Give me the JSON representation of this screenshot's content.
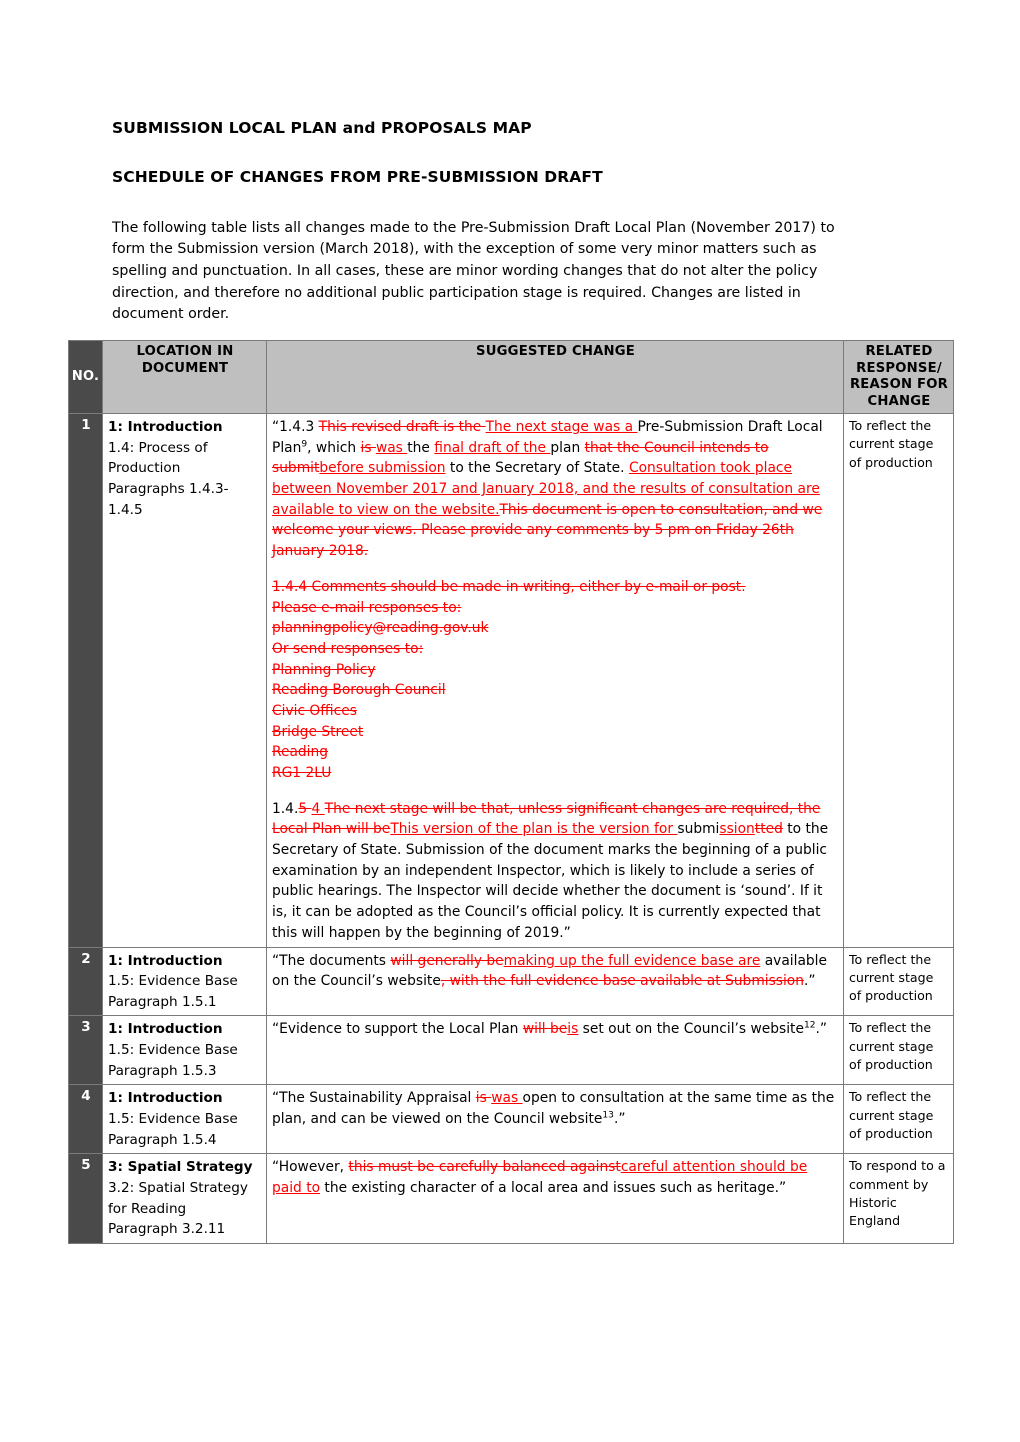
{
  "document": {
    "title": "SUBMISSION LOCAL PLAN and PROPOSALS MAP",
    "subtitle": "SCHEDULE OF CHANGES FROM PRE-SUBMISSION DRAFT",
    "intro": "The following table lists all changes made to the Pre-Submission Draft Local Plan (November 2017) to form the Submission version (March 2018), with the exception of some very minor matters such as spelling and punctuation.  In all cases, these are minor wording changes that do not alter the policy direction, and therefore no additional public participation stage is required. Changes are listed in document order."
  },
  "table": {
    "headers": {
      "no": "NO.",
      "location": "LOCATION IN DOCUMENT",
      "suggested": "SUGGESTED CHANGE",
      "related": "RELATED RESPONSE/ REASON FOR CHANGE"
    },
    "header_colors": {
      "no_bg": "#4a4a4a",
      "cell_bg": "#bfbfbf",
      "border": "#7b7b7b",
      "tracked_change": "#ff0000"
    },
    "rows": [
      {
        "no": "1",
        "location": {
          "heading": "1: Introduction",
          "lines": [
            "1.4: Process of Production",
            "Paragraphs 1.4.3-1.4.5"
          ]
        },
        "related": "To reflect the current stage of production",
        "suggested_paragraphs": [
          {
            "runs": [
              {
                "t": "“1.4.3 ",
                "k": "n"
              },
              {
                "t": "This revised draft is the ",
                "k": "d"
              },
              {
                "t": "The next stage was a ",
                "k": "i"
              },
              {
                "t": "Pre-Submission Draft Local Plan",
                "k": "n"
              },
              {
                "t": "9",
                "k": "sup"
              },
              {
                "t": ", which ",
                "k": "n"
              },
              {
                "t": "is ",
                "k": "d"
              },
              {
                "t": "was ",
                "k": "i"
              },
              {
                "t": "the ",
                "k": "n"
              },
              {
                "t": "final draft of the ",
                "k": "i"
              },
              {
                "t": "plan ",
                "k": "n"
              },
              {
                "t": "that the Council intends to submit",
                "k": "d"
              },
              {
                "t": "before submission",
                "k": "i"
              },
              {
                "t": " to the Secretary of State. ",
                "k": "n"
              },
              {
                "t": "Consultation took place between November 2017 and January 2018, and the results of consultation are available to view on the website.",
                "k": "i"
              },
              {
                "t": "This document is open to consultation, and we welcome your views. Please provide any comments by 5 pm on Friday 26th January 2018.",
                "k": "d"
              }
            ]
          },
          {
            "gap": true,
            "runs": [
              {
                "t": "1.4.4 Comments should be made in writing, either by e-mail or post.",
                "k": "dline"
              },
              {
                "t": "Please e-mail responses to:",
                "k": "dline"
              },
              {
                "t": "planningpolicy@reading.gov.uk",
                "k": "dline"
              },
              {
                "t": "Or send responses to:",
                "k": "dline"
              },
              {
                "t": "Planning Policy",
                "k": "dline"
              },
              {
                "t": "Reading Borough Council",
                "k": "dline"
              },
              {
                "t": "Civic Offices",
                "k": "dline"
              },
              {
                "t": "Bridge Street",
                "k": "dline"
              },
              {
                "t": "Reading",
                "k": "dline"
              },
              {
                "t": "RG1 2LU",
                "k": "dline"
              }
            ]
          },
          {
            "gap": true,
            "runs": [
              {
                "t": "1.4.",
                "k": "n"
              },
              {
                "t": "5 ",
                "k": "d"
              },
              {
                "t": "4 ",
                "k": "i"
              },
              {
                "t": "The next stage will be that, unless significant changes are required, the Local Plan will be",
                "k": "d"
              },
              {
                "t": "This version of the plan is the version for ",
                "k": "i"
              },
              {
                "t": "submi",
                "k": "n"
              },
              {
                "t": "ssion",
                "k": "i"
              },
              {
                "t": "tted",
                "k": "d"
              },
              {
                "t": " to the Secretary of State. Submission of the document marks the beginning of a public examination by an independent Inspector, which is likely to include a series of public hearings. The Inspector will decide whether the document is ‘sound’. If it is, it can be adopted as the Council’s official policy. It is currently expected that this will happen by the beginning of 2019.”",
                "k": "n"
              }
            ]
          }
        ]
      },
      {
        "no": "2",
        "location": {
          "heading": "1: Introduction",
          "lines": [
            "1.5: Evidence Base",
            "Paragraph 1.5.1"
          ]
        },
        "related": "To reflect the current stage of production",
        "suggested_paragraphs": [
          {
            "runs": [
              {
                "t": "“The documents ",
                "k": "n"
              },
              {
                "t": "will generally be",
                "k": "d"
              },
              {
                "t": "making up the full evidence base are",
                "k": "i"
              },
              {
                "t": " available on the Council’s website",
                "k": "n"
              },
              {
                "t": ", with the full evidence base available at Submission",
                "k": "d"
              },
              {
                "t": ".”",
                "k": "n"
              }
            ]
          }
        ]
      },
      {
        "no": "3",
        "location": {
          "heading": "1: Introduction",
          "lines": [
            "1.5: Evidence Base",
            "Paragraph 1.5.3"
          ]
        },
        "related": "To reflect the current stage of production",
        "suggested_paragraphs": [
          {
            "runs": [
              {
                "t": "“Evidence to support the Local Plan ",
                "k": "n"
              },
              {
                "t": "will be",
                "k": "d"
              },
              {
                "t": "is",
                "k": "i"
              },
              {
                "t": " set out on the Council’s website",
                "k": "n"
              },
              {
                "t": "12",
                "k": "sup"
              },
              {
                "t": ".”",
                "k": "n"
              }
            ]
          }
        ]
      },
      {
        "no": "4",
        "location": {
          "heading": "1: Introduction",
          "lines": [
            "1.5: Evidence Base",
            "Paragraph 1.5.4"
          ]
        },
        "related": "To reflect the current stage of production",
        "suggested_paragraphs": [
          {
            "runs": [
              {
                "t": "“The Sustainability Appraisal ",
                "k": "n"
              },
              {
                "t": "is ",
                "k": "d"
              },
              {
                "t": "was ",
                "k": "i"
              },
              {
                "t": "open to consultation at the same time as the plan, and can be viewed on the Council website",
                "k": "n"
              },
              {
                "t": "13",
                "k": "sup"
              },
              {
                "t": ".”",
                "k": "n"
              }
            ]
          }
        ]
      },
      {
        "no": "5",
        "location": {
          "heading": "3: Spatial Strategy",
          "lines": [
            "3.2: Spatial Strategy for Reading",
            "Paragraph 3.2.11"
          ]
        },
        "related": "To respond to a comment by Historic England",
        "suggested_paragraphs": [
          {
            "runs": [
              {
                "t": "“However, ",
                "k": "n"
              },
              {
                "t": "this must be carefully balanced against",
                "k": "d"
              },
              {
                "t": "careful attention should be paid to",
                "k": "i"
              },
              {
                "t": " the existing character of a local area and issues such as heritage.”",
                "k": "n"
              }
            ]
          }
        ]
      }
    ]
  }
}
